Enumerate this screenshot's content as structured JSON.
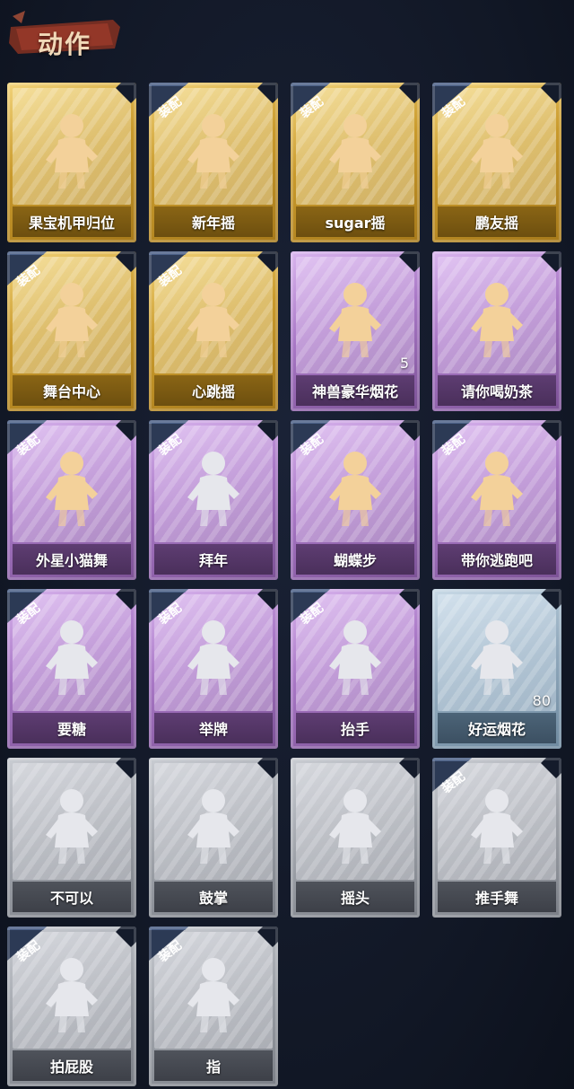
{
  "header": {
    "title": "动作"
  },
  "equipped_badge_text": "装配",
  "colors": {
    "gold": "#c99a2c",
    "purple": "#a978c6",
    "blue": "#92aabd",
    "gray": "#9ea2a9",
    "figure_gold": "#f3d19a",
    "figure_dim": "#e6e7ec"
  },
  "actions": [
    {
      "label": "果宝机甲归位",
      "tier": "gold",
      "equipped": false,
      "icon": "robot-dance-icon"
    },
    {
      "label": "新年摇",
      "tier": "gold",
      "equipped": true,
      "icon": "newyear-shake-icon"
    },
    {
      "label": "sugar摇",
      "tier": "gold",
      "equipped": true,
      "icon": "sugar-shake-icon"
    },
    {
      "label": "鹏友摇",
      "tier": "gold",
      "equipped": true,
      "icon": "friend-shake-icon"
    },
    {
      "label": "舞台中心",
      "tier": "gold",
      "equipped": true,
      "icon": "stage-center-icon"
    },
    {
      "label": "心跳摇",
      "tier": "gold",
      "equipped": true,
      "icon": "heartbeat-shake-icon"
    },
    {
      "label": "神兽豪华烟花",
      "tier": "purple",
      "equipped": false,
      "icon": "fireworks-box-icon",
      "count": "5"
    },
    {
      "label": "请你喝奶茶",
      "tier": "purple",
      "equipped": false,
      "icon": "milk-tea-icon"
    },
    {
      "label": "外星小猫舞",
      "tier": "purple",
      "equipped": true,
      "icon": "alien-cat-dance-icon"
    },
    {
      "label": "拜年",
      "tier": "purple",
      "equipped": true,
      "icon": "new-year-greeting-icon"
    },
    {
      "label": "蝴蝶步",
      "tier": "purple",
      "equipped": true,
      "icon": "butterfly-step-icon"
    },
    {
      "label": "带你逃跑吧",
      "tier": "purple",
      "equipped": true,
      "icon": "run-away-icon"
    },
    {
      "label": "要糖",
      "tier": "purple",
      "equipped": true,
      "icon": "ask-candy-icon"
    },
    {
      "label": "举牌",
      "tier": "purple",
      "equipped": true,
      "icon": "hold-sign-icon"
    },
    {
      "label": "抬手",
      "tier": "purple",
      "equipped": true,
      "icon": "raise-hand-icon"
    },
    {
      "label": "好运烟花",
      "tier": "blue",
      "equipped": false,
      "icon": "lucky-firework-icon",
      "count": "80"
    },
    {
      "label": "不可以",
      "tier": "gray",
      "equipped": false,
      "icon": "no-finger-icon"
    },
    {
      "label": "鼓掌",
      "tier": "gray",
      "equipped": false,
      "icon": "clap-icon"
    },
    {
      "label": "摇头",
      "tier": "gray",
      "equipped": false,
      "icon": "shake-head-icon"
    },
    {
      "label": "推手舞",
      "tier": "gray",
      "equipped": true,
      "icon": "push-hand-dance-icon"
    },
    {
      "label": "拍屁股",
      "tier": "gray",
      "equipped": true,
      "icon": "pat-butt-icon"
    },
    {
      "label": "指",
      "tier": "gray",
      "equipped": true,
      "icon": "point-icon"
    }
  ]
}
